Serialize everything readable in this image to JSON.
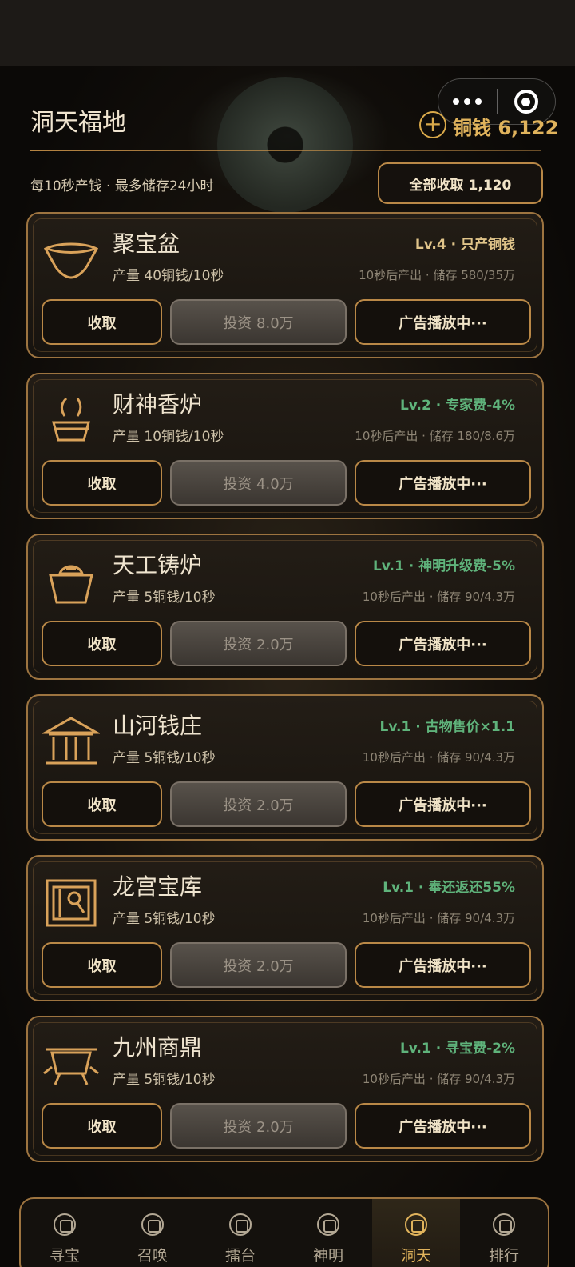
{
  "header": {
    "title": "洞天福地",
    "coins_label": "铜钱 6,122",
    "subtitle": "每10秒产钱 · 最多储存24小时",
    "collect_all_label": "全部收取 1,120"
  },
  "colors": {
    "accent_gold": "#e0b35c",
    "level_gold": "#e0c48a",
    "level_green": "#5fb37b",
    "card_border": "#9d7440"
  },
  "cards": [
    {
      "name": "聚宝盆",
      "icon": "treasure-bowl-icon",
      "output": "产量 40铜钱/10秒",
      "level": "Lv.4 · 只产铜钱",
      "level_color": "#e0c48a",
      "storage": "10秒后产出 · 储存 580/35万",
      "collect_label": "收取",
      "invest_label": "投资 8.0万",
      "ad_label": "广告播放中···"
    },
    {
      "name": "财神香炉",
      "icon": "incense-burner-icon",
      "output": "产量 10铜钱/10秒",
      "level": "Lv.2 · 专家费-4%",
      "level_color": "#5fb37b",
      "storage": "10秒后产出 · 储存 180/8.6万",
      "collect_label": "收取",
      "invest_label": "投资 4.0万",
      "ad_label": "广告播放中···"
    },
    {
      "name": "天工铸炉",
      "icon": "forge-icon",
      "output": "产量 5铜钱/10秒",
      "level": "Lv.1 · 神明升级费-5%",
      "level_color": "#5fb37b",
      "storage": "10秒后产出 · 储存 90/4.3万",
      "collect_label": "收取",
      "invest_label": "投资 2.0万",
      "ad_label": "广告播放中···"
    },
    {
      "name": "山河钱庄",
      "icon": "bank-icon",
      "output": "产量 5铜钱/10秒",
      "level": "Lv.1 · 古物售价×1.1",
      "level_color": "#5fb37b",
      "storage": "10秒后产出 · 储存 90/4.3万",
      "collect_label": "收取",
      "invest_label": "投资 2.0万",
      "ad_label": "广告播放中···"
    },
    {
      "name": "龙宫宝库",
      "icon": "vault-icon",
      "output": "产量 5铜钱/10秒",
      "level": "Lv.1 · 奉还返还55%",
      "level_color": "#5fb37b",
      "storage": "10秒后产出 · 储存 90/4.3万",
      "collect_label": "收取",
      "invest_label": "投资 2.0万",
      "ad_label": "广告播放中···"
    },
    {
      "name": "九州商鼎",
      "icon": "cauldron-icon",
      "output": "产量 5铜钱/10秒",
      "level": "Lv.1 · 寻宝费-2%",
      "level_color": "#5fb37b",
      "storage": "10秒后产出 · 储存 90/4.3万",
      "collect_label": "收取",
      "invest_label": "投资 2.0万",
      "ad_label": "广告播放中···"
    }
  ],
  "nav": [
    {
      "label": "寻宝",
      "icon": "treasure-hunt-icon",
      "active": false
    },
    {
      "label": "召唤",
      "icon": "summon-icon",
      "active": false
    },
    {
      "label": "擂台",
      "icon": "arena-icon",
      "active": false
    },
    {
      "label": "神明",
      "icon": "deity-icon",
      "active": false
    },
    {
      "label": "洞天",
      "icon": "cave-home-icon",
      "active": true
    },
    {
      "label": "排行",
      "icon": "ranking-icon",
      "active": false
    }
  ]
}
